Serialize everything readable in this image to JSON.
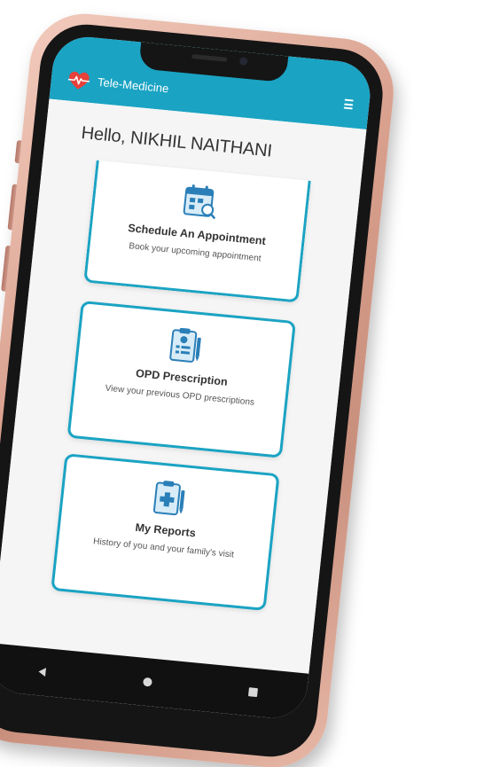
{
  "app": {
    "title": "Tele-Medicine",
    "accent_color": "#1aa3c3"
  },
  "greeting": "Hello, NIKHIL NAITHANI",
  "cards": [
    {
      "icon": "calendar-search-icon",
      "title": "Schedule An Appointment",
      "subtitle": "Book your upcoming appointment"
    },
    {
      "icon": "prescription-clipboard-icon",
      "title": "OPD Prescription",
      "subtitle": "View your previous OPD prescriptions"
    },
    {
      "icon": "medical-report-icon",
      "title": "My Reports",
      "subtitle": "History of you and your family's visit"
    }
  ],
  "icons": {
    "logo": "heart-pulse-icon",
    "menu": "hamburger-menu-icon",
    "nav_back": "back-triangle-icon",
    "nav_home": "home-circle-icon",
    "nav_recent": "recent-square-icon"
  }
}
